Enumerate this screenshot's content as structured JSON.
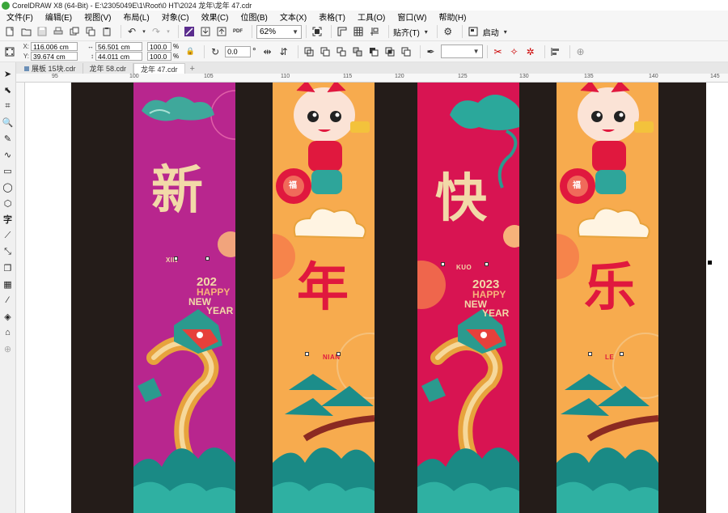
{
  "window": {
    "title": "CorelDRAW X8 (64-Bit) - E:\\2305049E\\1\\Root\\0 HT\\2024 龙年\\龙年 47.cdr"
  },
  "menu": [
    "文件(F)",
    "编辑(E)",
    "视图(V)",
    "布局(L)",
    "对象(C)",
    "效果(C)",
    "位图(B)",
    "文本(X)",
    "表格(T)",
    "工具(O)",
    "窗口(W)",
    "帮助(H)"
  ],
  "toolbar": {
    "zoom": "62%",
    "snap_label": "贴齐(T)",
    "launch_label": "启动"
  },
  "property_bar": {
    "x_label": "X:",
    "x_value": "116.006 cm",
    "y_label": "Y:",
    "y_value": "39.674 cm",
    "width_value": "56.501 cm",
    "height_value": "44.011 cm",
    "scale_w": "100.0",
    "scale_h": "100.0",
    "percent": "%",
    "rotation": "0.0",
    "degree": "°"
  },
  "tabs": [
    {
      "label": "展板 15块.cdr",
      "active": false
    },
    {
      "label": "龙年 58.cdr",
      "active": false
    },
    {
      "label": "龙年 47.cdr",
      "active": true
    }
  ],
  "ruler": {
    "labels": [
      "95",
      "100",
      "105",
      "110",
      "115",
      "120",
      "125",
      "130",
      "135",
      "140",
      "145"
    ]
  },
  "banners": [
    {
      "char": "新",
      "pinyin": "XIN",
      "greet_year": "202",
      "greet_l1": "HAPPY",
      "greet_l2": "NEW",
      "greet_l3": "YEAR",
      "bg": "#b8268e",
      "char_color": "#f2d9a8"
    },
    {
      "char": "年",
      "pinyin": "NIAN",
      "bg": "#f7ab4e",
      "char_color": "#e0183e"
    },
    {
      "char": "快",
      "pinyin": "KUO",
      "greet_year": "2023",
      "greet_l1": "HAPPY",
      "greet_l2": "NEW",
      "greet_l3": "YEAR",
      "bg": "#d81452",
      "char_color": "#f2d9a8"
    },
    {
      "char": "乐",
      "pinyin": "LE",
      "bg": "#f7ab4e",
      "char_color": "#e0183e"
    }
  ],
  "banner_lantern_char": "福",
  "colors": {
    "dark_bg": "#241c19",
    "magenta": "#b8268e",
    "red": "#d81452",
    "orange": "#f7ab4e",
    "gold": "#f2d9a8",
    "teal": "#1f8f86"
  },
  "icons": [
    "new-icon",
    "open-icon",
    "save-icon",
    "print-icon",
    "cut-icon",
    "copy-icon",
    "paste-icon",
    "undo-icon",
    "redo-icon",
    "import-icon",
    "export-icon",
    "pdf-icon",
    "fullscreen-icon",
    "rulers-icon",
    "grid-icon",
    "settings-icon",
    "launch-icon"
  ]
}
